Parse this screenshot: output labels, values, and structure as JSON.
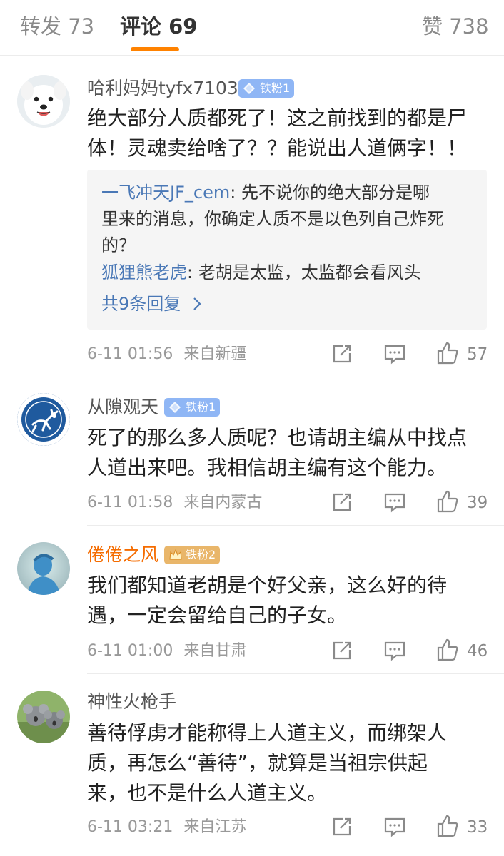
{
  "tabs": {
    "repost": "转发 73",
    "comments": "评论 69",
    "likes": "赞 738"
  },
  "colors": {
    "accent": "#ff8200",
    "link": "#4a78b6",
    "fan_badge": "#8fb6f5",
    "fan_badge_gold": "#e9b66a"
  },
  "comments": [
    {
      "username": "哈利妈妈tyfx7103",
      "badge": "铁粉1",
      "avatar": "white-dog-avatar",
      "text": [
        "绝大部分人质都死了！这之前找到的都是尸",
        "体！灵魂卖给啥了？？能说出人道俩字！！"
      ],
      "replies": [
        {
          "user": "一飞冲天JF_cem",
          "lines": [
            "先不说你的绝大部分是哪",
            "里来的消息，你确定人质不是以色列自己炸死",
            "的？"
          ]
        },
        {
          "user": "狐狸熊老虎",
          "lines": [
            "老胡是太监，太监都会看风头"
          ]
        }
      ],
      "more_replies": "共9条回复",
      "time": "6-11 01:56",
      "source": "来自新疆",
      "likes": "57"
    },
    {
      "username": "从隙观天",
      "badge": "铁粉1",
      "avatar": "deer-logo-avatar",
      "text": [
        "死了的那么多人质呢？也请胡主编从中找点",
        "人道出来吧。我相信胡主编有这个能力。"
      ],
      "time": "6-11 01:58",
      "source": "来自内蒙古",
      "likes": "39"
    },
    {
      "username": "倦倦之风",
      "badge": "铁粉2",
      "avatar": "blue-silhouette-avatar",
      "text": [
        "我们都知道老胡是个好父亲，这么好的待",
        "遇，一定会留给自己的子女。"
      ],
      "time": "6-11 01:00",
      "source": "来自甘肃",
      "likes": "46"
    },
    {
      "username": "神性火枪手",
      "avatar": "koala-avatar",
      "text": [
        "善待俘虏才能称得上人道主义，而绑架人",
        "质，再怎么“善待”，就算是当祖宗供起",
        "来，也不是什么人道主义。"
      ],
      "time": "6-11 03:21",
      "source": "来自江苏",
      "likes": "33"
    }
  ]
}
